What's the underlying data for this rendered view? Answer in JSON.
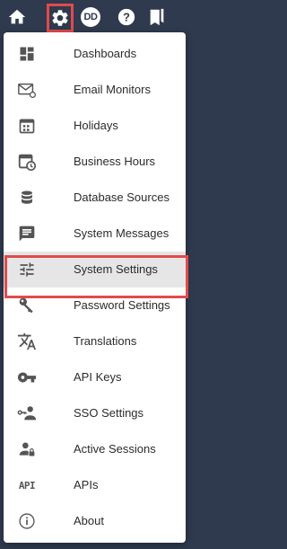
{
  "topbar": {
    "user_initials": "DD",
    "icons": [
      "home-icon",
      "gear-icon",
      "avatar",
      "help-icon",
      "bookmarks-icon"
    ]
  },
  "menu": {
    "items": [
      {
        "label": "Dashboards",
        "icon": "dashboard-icon"
      },
      {
        "label": "Email Monitors",
        "icon": "email-sync-icon"
      },
      {
        "label": "Holidays",
        "icon": "calendar-icon"
      },
      {
        "label": "Business Hours",
        "icon": "calendar-clock-icon"
      },
      {
        "label": "Database Sources",
        "icon": "database-icon"
      },
      {
        "label": "System Messages",
        "icon": "message-icon"
      },
      {
        "label": "System Settings",
        "icon": "sliders-icon"
      },
      {
        "label": "Password Settings",
        "icon": "key-icon"
      },
      {
        "label": "Translations",
        "icon": "translate-icon"
      },
      {
        "label": "API Keys",
        "icon": "vpn-key-icon"
      },
      {
        "label": "SSO Settings",
        "icon": "sso-user-key-icon"
      },
      {
        "label": "Active Sessions",
        "icon": "user-lock-icon"
      },
      {
        "label": "APIs",
        "icon": "api-icon"
      },
      {
        "label": "About",
        "icon": "info-icon"
      }
    ],
    "selected": "System Settings"
  },
  "colors": {
    "topbar": "#2f3a4e",
    "highlight": "#e04b4b",
    "icon": "#555555",
    "selected_bg": "#e6e6e6"
  }
}
